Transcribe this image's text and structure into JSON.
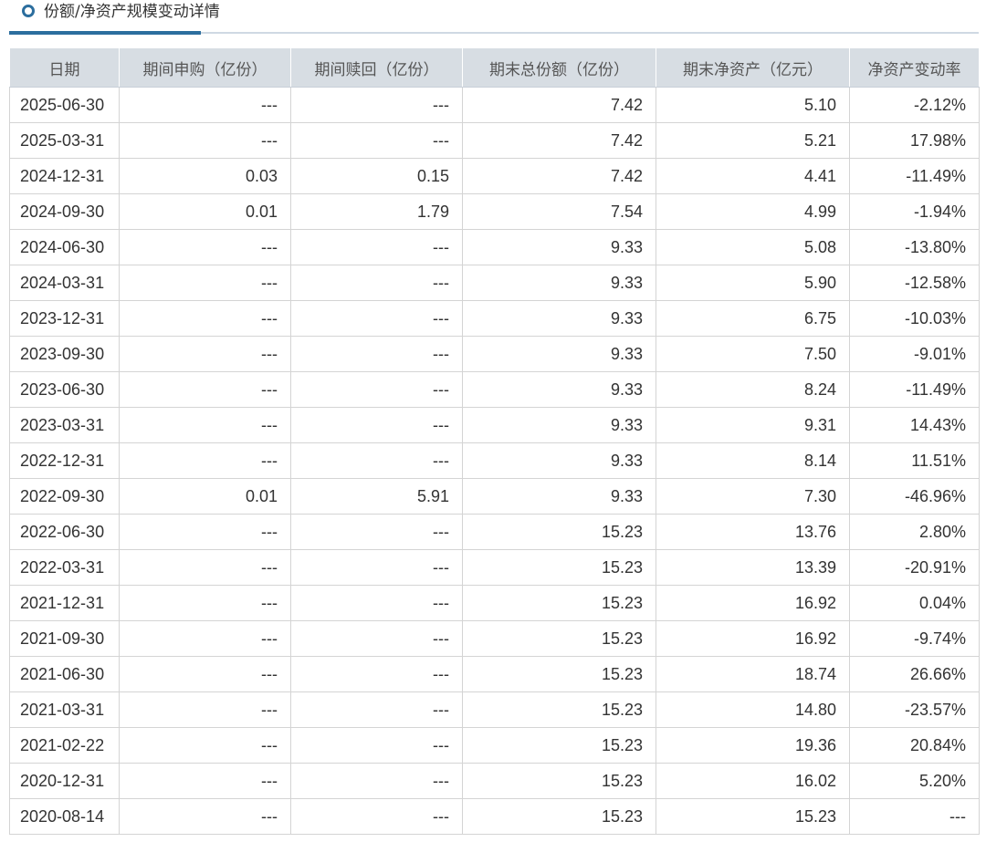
{
  "section": {
    "icon": "circle-icon",
    "title": "份额/净资产规模变动详情"
  },
  "table": {
    "headers": [
      "日期",
      "期间申购（亿份）",
      "期间赎回（亿份）",
      "期末总份额（亿份）",
      "期末净资产（亿元）",
      "净资产变动率"
    ],
    "rows": [
      [
        "2025-06-30",
        "---",
        "---",
        "7.42",
        "5.10",
        "-2.12%"
      ],
      [
        "2025-03-31",
        "---",
        "---",
        "7.42",
        "5.21",
        "17.98%"
      ],
      [
        "2024-12-31",
        "0.03",
        "0.15",
        "7.42",
        "4.41",
        "-11.49%"
      ],
      [
        "2024-09-30",
        "0.01",
        "1.79",
        "7.54",
        "4.99",
        "-1.94%"
      ],
      [
        "2024-06-30",
        "---",
        "---",
        "9.33",
        "5.08",
        "-13.80%"
      ],
      [
        "2024-03-31",
        "---",
        "---",
        "9.33",
        "5.90",
        "-12.58%"
      ],
      [
        "2023-12-31",
        "---",
        "---",
        "9.33",
        "6.75",
        "-10.03%"
      ],
      [
        "2023-09-30",
        "---",
        "---",
        "9.33",
        "7.50",
        "-9.01%"
      ],
      [
        "2023-06-30",
        "---",
        "---",
        "9.33",
        "8.24",
        "-11.49%"
      ],
      [
        "2023-03-31",
        "---",
        "---",
        "9.33",
        "9.31",
        "14.43%"
      ],
      [
        "2022-12-31",
        "---",
        "---",
        "9.33",
        "8.14",
        "11.51%"
      ],
      [
        "2022-09-30",
        "0.01",
        "5.91",
        "9.33",
        "7.30",
        "-46.96%"
      ],
      [
        "2022-06-30",
        "---",
        "---",
        "15.23",
        "13.76",
        "2.80%"
      ],
      [
        "2022-03-31",
        "---",
        "---",
        "15.23",
        "13.39",
        "-20.91%"
      ],
      [
        "2021-12-31",
        "---",
        "---",
        "15.23",
        "16.92",
        "0.04%"
      ],
      [
        "2021-09-30",
        "---",
        "---",
        "15.23",
        "16.92",
        "-9.74%"
      ],
      [
        "2021-06-30",
        "---",
        "---",
        "15.23",
        "18.74",
        "26.66%"
      ],
      [
        "2021-03-31",
        "---",
        "---",
        "15.23",
        "14.80",
        "-23.57%"
      ],
      [
        "2021-02-22",
        "---",
        "---",
        "15.23",
        "19.36",
        "20.84%"
      ],
      [
        "2020-12-31",
        "---",
        "---",
        "15.23",
        "16.02",
        "5.20%"
      ],
      [
        "2020-08-14",
        "---",
        "---",
        "15.23",
        "15.23",
        "---"
      ]
    ]
  }
}
